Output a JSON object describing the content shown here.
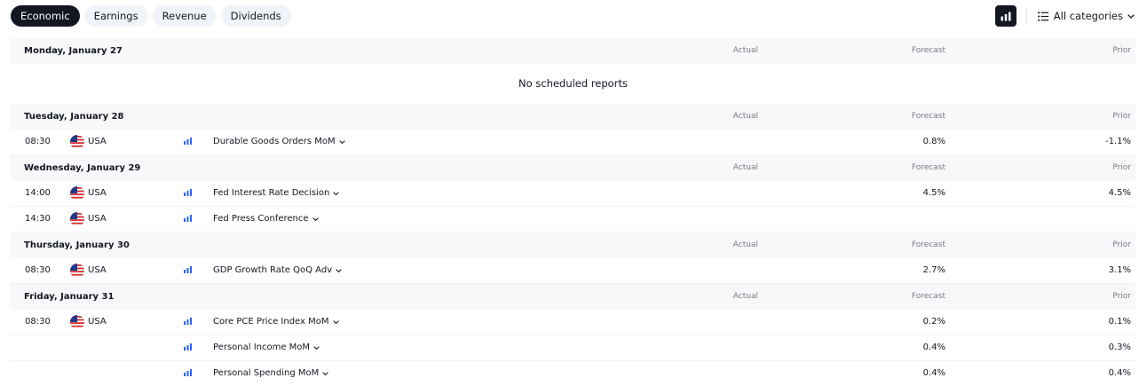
{
  "tabs": [
    {
      "label": "Economic",
      "active": true
    },
    {
      "label": "Earnings",
      "active": false
    },
    {
      "label": "Revenue",
      "active": false
    },
    {
      "label": "Dividends",
      "active": false
    }
  ],
  "toolbar": {
    "chart_icon": "bar-chart-icon",
    "categories_label": "All categories",
    "categories_icon": "list-icon"
  },
  "columns": {
    "actual": "Actual",
    "forecast": "Forecast",
    "prior": "Prior"
  },
  "days": [
    {
      "date": "Monday, January 27",
      "empty_text": "No scheduled reports",
      "events": []
    },
    {
      "date": "Tuesday, January 28",
      "events": [
        {
          "time": "08:30",
          "country": "USA",
          "name": "Durable Goods Orders MoM",
          "forecast": "0.8%",
          "prior": "-1.1%"
        }
      ]
    },
    {
      "date": "Wednesday, January 29",
      "events": [
        {
          "time": "14:00",
          "country": "USA",
          "name": "Fed Interest Rate Decision",
          "forecast": "4.5%",
          "prior": "4.5%"
        },
        {
          "time": "14:30",
          "country": "USA",
          "name": "Fed Press Conference",
          "forecast": "",
          "prior": ""
        }
      ]
    },
    {
      "date": "Thursday, January 30",
      "events": [
        {
          "time": "08:30",
          "country": "USA",
          "name": "GDP Growth Rate QoQ Adv",
          "forecast": "2.7%",
          "prior": "3.1%"
        }
      ]
    },
    {
      "date": "Friday, January 31",
      "events": [
        {
          "time": "08:30",
          "country": "USA",
          "name": "Core PCE Price Index MoM",
          "forecast": "0.2%",
          "prior": "0.1%"
        },
        {
          "time": "",
          "country": "",
          "name": "Personal Income MoM",
          "forecast": "0.4%",
          "prior": "0.3%"
        },
        {
          "time": "",
          "country": "",
          "name": "Personal Spending MoM",
          "forecast": "0.4%",
          "prior": "0.4%"
        }
      ]
    }
  ],
  "colors": {
    "active_tab": "#131722",
    "importance": "#2962ff",
    "header_bg": "#f7f8fa"
  }
}
